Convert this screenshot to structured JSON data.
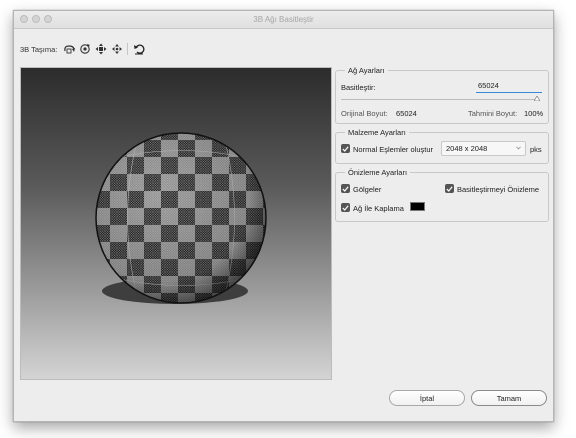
{
  "window": {
    "title": "3B Ağı Basitleştir"
  },
  "toolbar": {
    "label": "3B Taşıma:",
    "tools": [
      {
        "name": "rotate-3d-icon"
      },
      {
        "name": "roll-3d-icon"
      },
      {
        "name": "drag-3d-icon"
      },
      {
        "name": "slide-3d-icon"
      },
      {
        "name": "reset-view-icon"
      }
    ]
  },
  "mesh_settings": {
    "title": "Ağ Ayarları",
    "simplify_label": "Basitleştir:",
    "simplify_value": "65024",
    "slider_fraction": 1.0,
    "original_size_label": "Orijinal Boyut:",
    "original_size_value": "65024",
    "estimated_size_label": "Tahmini Boyut:",
    "estimated_size_value": "100%"
  },
  "material_settings": {
    "title": "Malzeme Ayarları",
    "normal_maps_label": "Normal Eşlemler oluştur",
    "normal_maps_checked": true,
    "size_value": "2048 x 2048",
    "unit": "pks"
  },
  "preview_settings": {
    "title": "Önizleme Ayarları",
    "shadows_label": "Gölgeler",
    "shadows_checked": true,
    "preview_simplified_label": "Basitleştirmeyi Önizleme",
    "preview_simplified_checked": true,
    "mesh_overlay_label": "Ağ İle Kaplama",
    "mesh_overlay_checked": true,
    "mesh_color": "#000000"
  },
  "buttons": {
    "cancel": "İptal",
    "ok": "Tamam"
  },
  "colors": {
    "accent": "#3b88d8",
    "checkbox": "#555555"
  }
}
